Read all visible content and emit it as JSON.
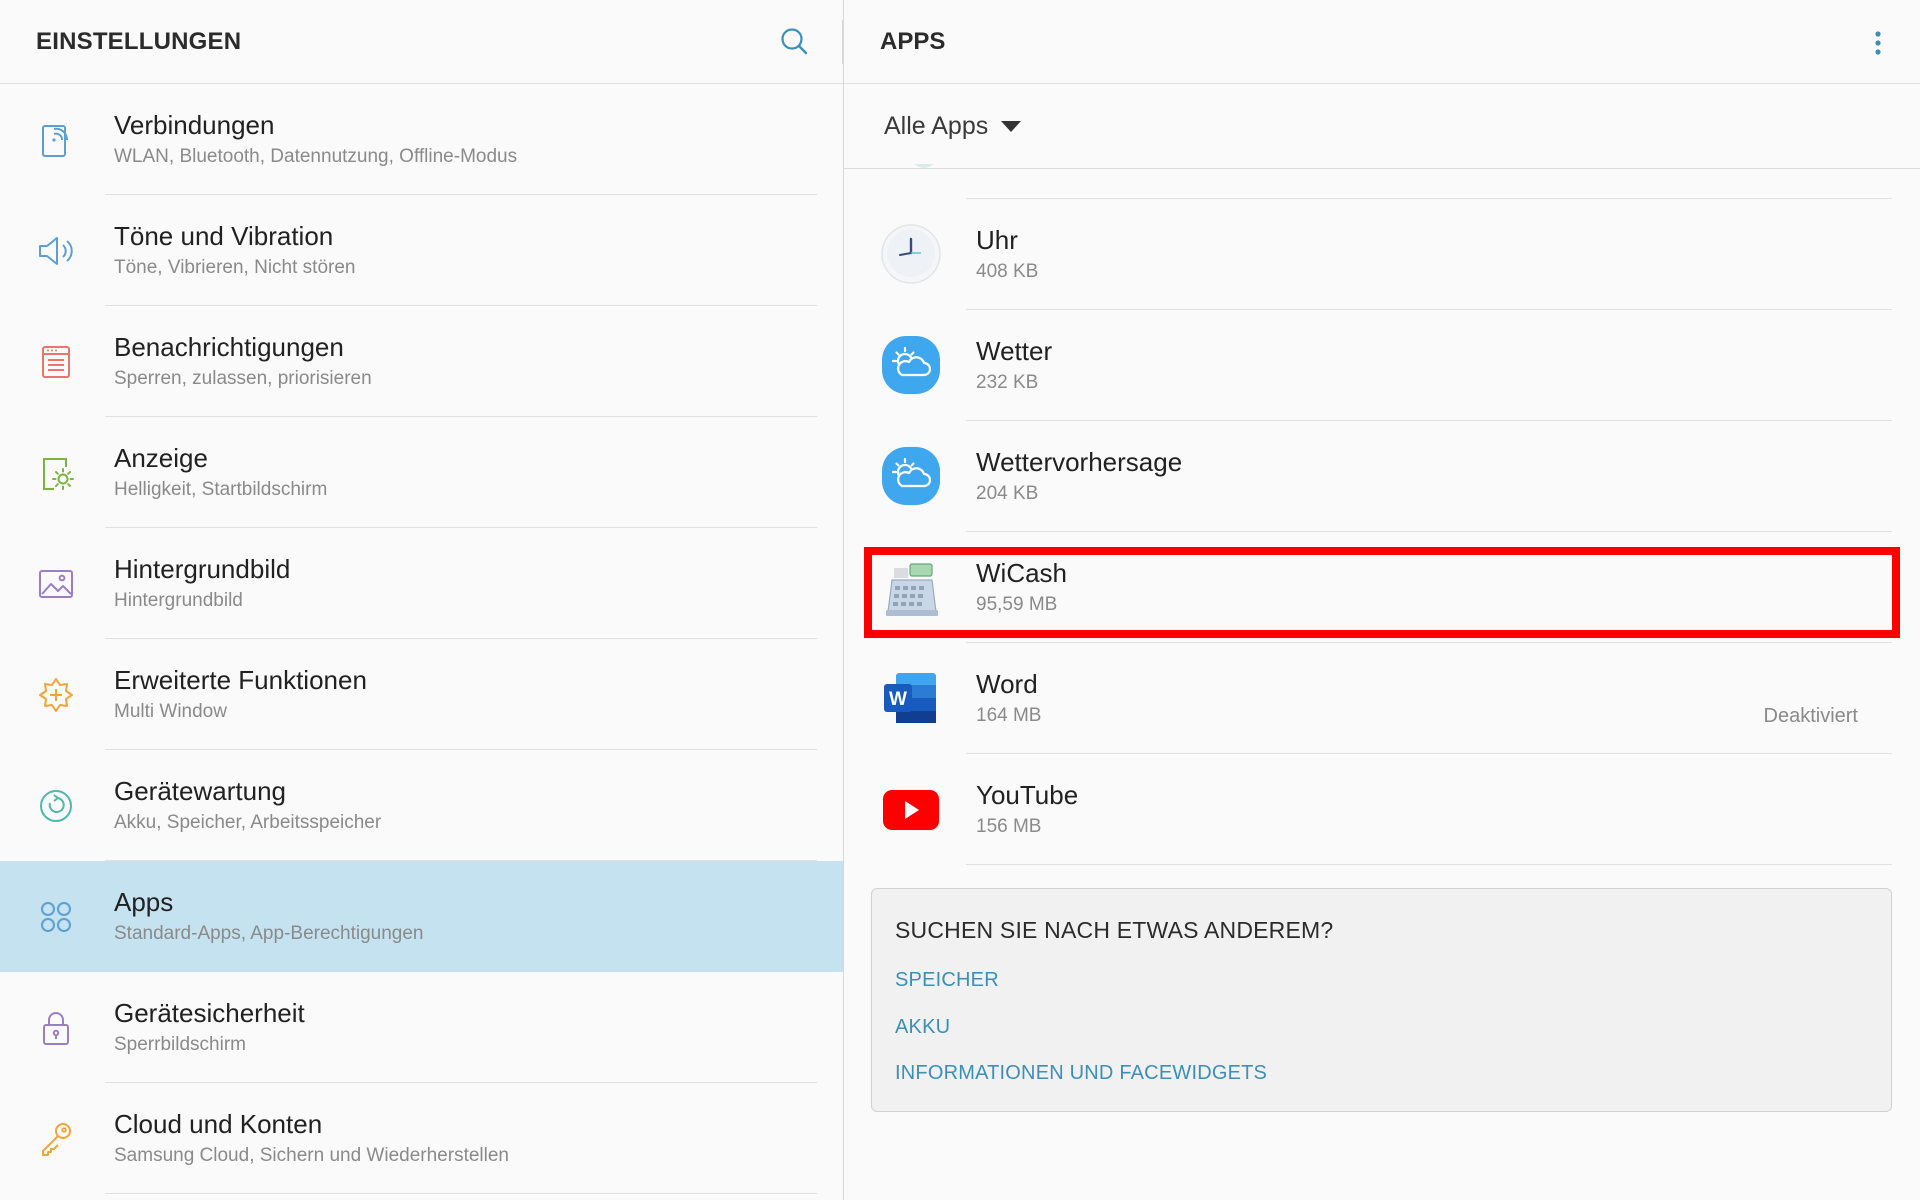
{
  "colors": {
    "active_bg": "#c4e2f0",
    "highlight": "#ff0000",
    "link": "#3c8fb8"
  },
  "left": {
    "title": "EINSTELLUNGEN",
    "search_icon": "search-icon",
    "items": [
      {
        "title": "Verbindungen",
        "subtitle": "WLAN, Bluetooth, Datennutzung, Offline-Modus",
        "icon": "connections-icon"
      },
      {
        "title": "Töne und Vibration",
        "subtitle": "Töne, Vibrieren, Nicht stören",
        "icon": "speaker-icon"
      },
      {
        "title": "Benachrichtigungen",
        "subtitle": "Sperren, zulassen, priorisieren",
        "icon": "notifications-icon"
      },
      {
        "title": "Anzeige",
        "subtitle": "Helligkeit, Startbildschirm",
        "icon": "display-icon"
      },
      {
        "title": "Hintergrundbild",
        "subtitle": "Hintergrundbild",
        "icon": "wallpaper-icon"
      },
      {
        "title": "Erweiterte Funktionen",
        "subtitle": "Multi Window",
        "icon": "advanced-features-icon"
      },
      {
        "title": "Gerätewartung",
        "subtitle": "Akku, Speicher, Arbeitsspeicher",
        "icon": "device-maintenance-icon"
      },
      {
        "title": "Apps",
        "subtitle": "Standard-Apps, App-Berechtigungen",
        "icon": "apps-icon",
        "active": true
      },
      {
        "title": "Gerätesicherheit",
        "subtitle": "Sperrbildschirm",
        "icon": "lock-icon"
      },
      {
        "title": "Cloud und Konten",
        "subtitle": "Samsung Cloud, Sichern und Wiederherstellen",
        "icon": "key-icon"
      }
    ]
  },
  "right": {
    "title": "APPS",
    "more_icon": "more-vert-icon",
    "filter": {
      "label": "Alle Apps",
      "icon": "dropdown-arrow-icon"
    },
    "apps": [
      {
        "name": "Uhr",
        "size": "408 KB",
        "status": "",
        "icon": "clock-icon"
      },
      {
        "name": "Wetter",
        "size": "232 KB",
        "status": "",
        "icon": "weather-icon"
      },
      {
        "name": "Wettervorhersage",
        "size": "204 KB",
        "status": "",
        "icon": "weather-forecast-icon"
      },
      {
        "name": "WiCash",
        "size": "95,59 MB",
        "status": "",
        "icon": "cash-register-icon",
        "highlighted": true
      },
      {
        "name": "Word",
        "size": "164 MB",
        "status": "Deaktiviert",
        "icon": "word-icon"
      },
      {
        "name": "YouTube",
        "size": "156 MB",
        "status": "",
        "icon": "youtube-icon"
      }
    ],
    "suggestions": {
      "title": "SUCHEN SIE NACH ETWAS ANDEREM?",
      "links": [
        "SPEICHER",
        "AKKU",
        "INFORMATIONEN UND FACEWIDGETS"
      ]
    }
  }
}
